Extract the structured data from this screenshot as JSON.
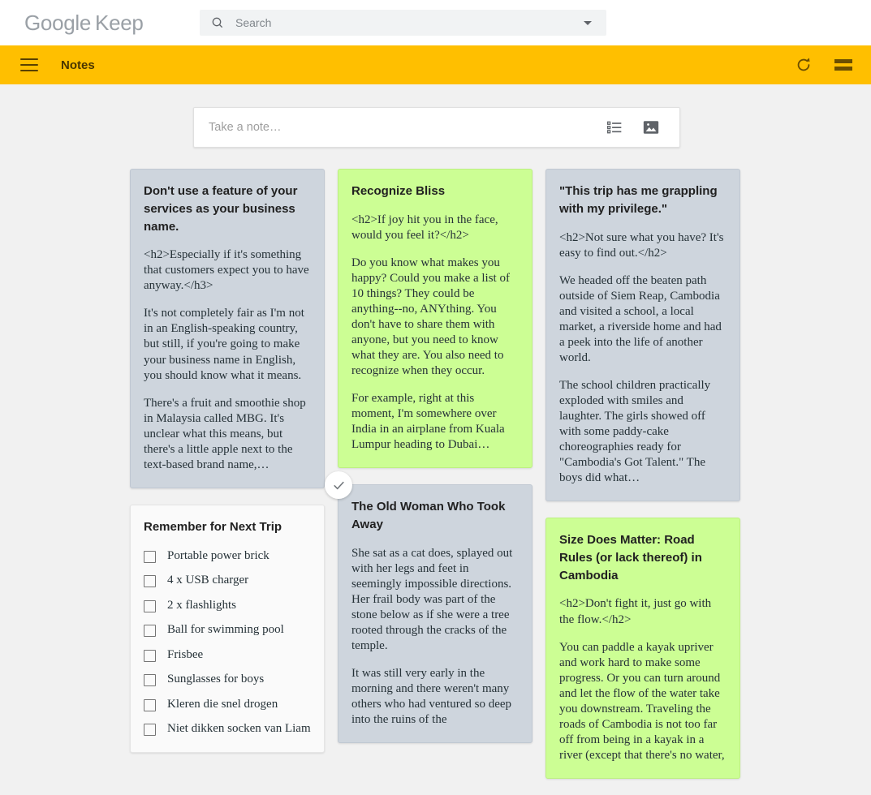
{
  "app": {
    "brand_google": "Google",
    "brand_keep": "Keep",
    "logo_color": "#9aa0a6",
    "accent_yellow": "#ffbf00"
  },
  "search": {
    "placeholder": "Search",
    "value": "",
    "icon": "search-icon",
    "caret_icon": "chevron-down-icon"
  },
  "appbar": {
    "menu_icon": "hamburger-menu-icon",
    "title": "Notes",
    "refresh_icon": "refresh-icon",
    "view_toggle_icon": "list-view-icon"
  },
  "take_note": {
    "placeholder": "Take a note…",
    "checklist_icon": "new-list-icon",
    "image_icon": "new-image-icon"
  },
  "notes": [
    {
      "id": "note-business-name",
      "color": "gray",
      "color_hex": "#ced5dd",
      "selected": false,
      "title": "Don't use a feature of your services as your business name.",
      "paragraphs": [
        "<h2>Especially if it's something that customers expect you to have anyway.</h3>",
        "It's not completely fair as I'm not in an English-speaking country, but still, if you're going to make your business name in English, you should know what it means.",
        "There's a fruit and smoothie shop in Malaysia called MBG. It's unclear what this means, but there's a little apple next to the text-based brand name,…"
      ]
    },
    {
      "id": "note-remember-trip",
      "color": "white",
      "color_hex": "#fafafa",
      "selected": false,
      "title": "Remember for Next Trip",
      "checklist": [
        {
          "label": "Portable power brick",
          "checked": false
        },
        {
          "label": "4 x USB charger",
          "checked": false
        },
        {
          "label": "2 x flashlights",
          "checked": false
        },
        {
          "label": "Ball for swimming pool",
          "checked": false
        },
        {
          "label": "Frisbee",
          "checked": false
        },
        {
          "label": "Sunglasses for boys",
          "checked": false
        },
        {
          "label": "Kleren die snel drogen",
          "checked": false
        },
        {
          "label": "Niet dikken socken van Liam",
          "checked": false
        }
      ]
    },
    {
      "id": "note-recognize-bliss",
      "color": "green",
      "color_hex": "#ccfe94",
      "selected": false,
      "title": "Recognize Bliss",
      "paragraphs": [
        "<h2>If joy hit you in the face, would you feel it?</h2>",
        "Do you know what makes you happy? Could you make a list of 10 things? They could be anything--no, ANYthing. You don't have to share them with anyone, but you need to know what they are. You also need to recognize when they occur.",
        "For example, right at this moment, I'm somewhere over India in an airplane from Kuala Lumpur heading to Dubai…"
      ]
    },
    {
      "id": "note-old-woman",
      "color": "gray",
      "color_hex": "#ced5dd",
      "selected": true,
      "select_badge_icon": "check-circle-icon",
      "title": "The Old Woman Who Took Away",
      "paragraphs": [
        "She sat as a cat does, splayed out with her legs and feet in seemingly impossible directions. Her frail body was part of the stone below as if she were a tree rooted through the cracks of the temple.",
        "It was still very early in the morning and there weren't many others who had ventured so deep into the ruins of the"
      ]
    },
    {
      "id": "note-privilege",
      "color": "gray",
      "color_hex": "#ced5dd",
      "selected": false,
      "title": "\"This trip has me grappling with my privilege.\"",
      "paragraphs": [
        "<h2>Not sure what you have? It's easy to find out.</h2>",
        "We headed off the beaten path outside of Siem Reap, Cambodia and visited a school, a local market, a riverside home and had a peek into the life of another world.",
        "The school children practically exploded with smiles and laughter. The girls showed off with some paddy-cake choreographies ready for \"Cambodia's Got Talent.\" The boys did what…"
      ]
    },
    {
      "id": "note-road-rules",
      "color": "green",
      "color_hex": "#ccfe94",
      "selected": false,
      "title": "Size Does Matter: Road Rules (or lack thereof) in Cambodia",
      "paragraphs": [
        "<h2>Don't fight it, just go with the flow.</h2>",
        "You can paddle a kayak upriver and work hard to make some progress. Or you can turn around and let the flow of the water take you downstream. Traveling the roads of Cambodia is not too far off from being in a kayak in a river (except that there's no water,"
      ]
    }
  ]
}
